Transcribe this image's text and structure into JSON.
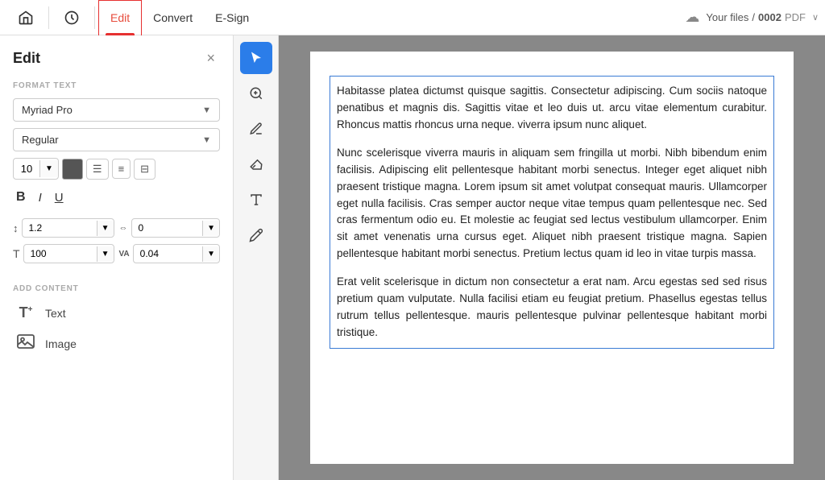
{
  "header": {
    "nav_items": [
      {
        "id": "home",
        "label": "⌂",
        "icon": true
      },
      {
        "id": "history",
        "label": "↺",
        "icon": true
      },
      {
        "id": "edit",
        "label": "Edit",
        "active": true
      },
      {
        "id": "convert",
        "label": "Convert"
      },
      {
        "id": "esign",
        "label": "E-Sign"
      }
    ],
    "cloud_label": "Your files",
    "file_separator": "/",
    "file_number": "0002",
    "file_type": "PDF",
    "dropdown_arrow": "∨"
  },
  "sidebar": {
    "title": "Edit",
    "close_label": "×",
    "format_text_label": "FORMAT TEXT",
    "font_family": "Myriad Pro",
    "font_style": "Regular",
    "font_size": "10",
    "bold_label": "B",
    "italic_label": "I",
    "underline_label": "U",
    "line_spacing_icon": "≡",
    "line_spacing_val": "1.2",
    "char_spacing_icon": "⇤⇥",
    "char_spacing_val": "0",
    "scale_icon": "T",
    "scale_val": "100",
    "tracking_icon": "VA",
    "tracking_val": "0.04",
    "add_content_label": "ADD CONTENT",
    "add_items": [
      {
        "id": "text",
        "icon": "T+",
        "label": "Text"
      },
      {
        "id": "image",
        "icon": "⊞",
        "label": "Image"
      }
    ]
  },
  "toolbar": {
    "tools": [
      {
        "id": "select",
        "icon": "↖",
        "active": true
      },
      {
        "id": "pan",
        "icon": "⊕"
      },
      {
        "id": "annotate",
        "icon": "✏"
      },
      {
        "id": "eraser",
        "icon": "ε"
      },
      {
        "id": "text-tool",
        "icon": "A"
      },
      {
        "id": "stamp",
        "icon": "✍"
      }
    ]
  },
  "pdf": {
    "paragraphs": [
      "Habitasse platea dictumst quisque sagittis. Consectetur adipiscing. Cum sociis natoque penatibus et magnis dis. Sagittis vitae et leo duis ut. arcu vitae elementum curabitur. Rhoncus mattis rhoncus urna neque. viverra ipsum nunc aliquet.",
      "Nunc scelerisque viverra mauris in aliquam sem fringilla ut morbi. Nibh bibendum enim facilisis. Adipiscing elit pellentesque habitant morbi senectus. Integer eget aliquet nibh praesent tristique magna. Lorem ipsum sit amet volutpat consequat mauris. Ullamcorper eget nulla facilisis. Cras semper auctor neque vitae tempus quam pellentesque nec. Sed cras fermentum odio eu. Et molestie ac feugiat sed lectus vestibulum ullamcorper. Enim sit amet venenatis urna cursus eget. Aliquet nibh praesent tristique magna. Sapien pellentesque habitant morbi senectus. Pretium lectus quam id leo in vitae turpis massa.",
      "Erat velit scelerisque in dictum non consectetur a erat nam. Arcu egestas sed sed risus pretium quam vulputate. Nulla facilisi etiam eu feugiat pretium. Phasellus egestas tellus rutrum tellus pellentesque. mauris pellentesque pulvinar pellentesque habitant morbi tristique."
    ]
  }
}
